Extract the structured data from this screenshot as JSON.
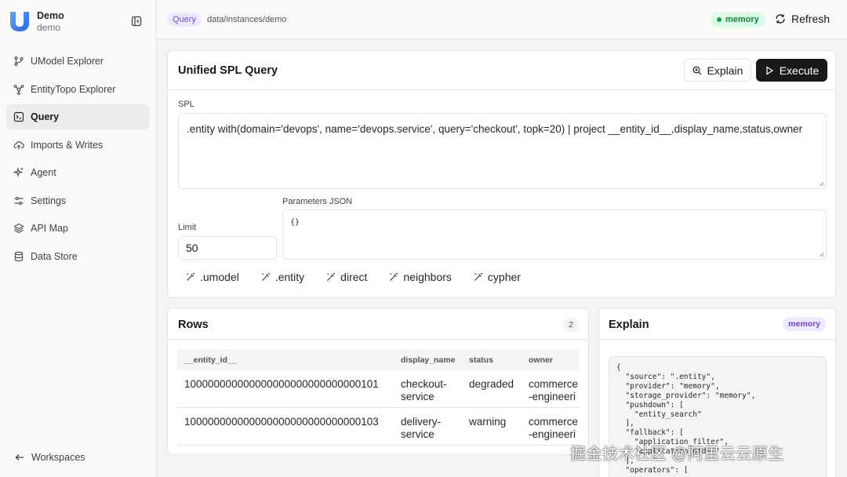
{
  "app": {
    "name": "Demo",
    "workspace": "demo"
  },
  "sidebar": {
    "items": [
      {
        "label": "UModel Explorer",
        "icon": "git-branch-icon"
      },
      {
        "label": "EntityTopo Explorer",
        "icon": "topology-icon"
      },
      {
        "label": "Query",
        "icon": "terminal-square-icon",
        "active": true
      },
      {
        "label": "Imports & Writes",
        "icon": "cloud-upload-icon"
      },
      {
        "label": "Agent",
        "icon": "sparkles-icon"
      },
      {
        "label": "Settings",
        "icon": "sliders-icon"
      },
      {
        "label": "API Map",
        "icon": "layers-icon"
      },
      {
        "label": "Data Store",
        "icon": "database-icon"
      }
    ],
    "footer_label": "Workspaces"
  },
  "topbar": {
    "section_badge": "Query",
    "path": "data/instances/demo",
    "status_badge": "memory",
    "refresh_label": "Refresh"
  },
  "query_card": {
    "title": "Unified SPL Query",
    "explain_label": "Explain",
    "execute_label": "Execute",
    "spl_label": "SPL",
    "spl_value": ".entity with(domain='devops', name='devops.service', query='checkout', topk=20) | project __entity_id__,display_name,status,owner",
    "params_label": "Parameters JSON",
    "params_value": "{}",
    "limit_label": "Limit",
    "limit_value": "50",
    "templates": [
      ".umodel",
      ".entity",
      "direct",
      "neighbors",
      "cypher"
    ]
  },
  "rows_card": {
    "title": "Rows",
    "count": "2",
    "columns": [
      "__entity_id__",
      "display_name",
      "status",
      "owner"
    ],
    "rows": [
      [
        "100000000000000000000000000000101",
        "checkout-service",
        "degraded",
        "commerce-engineering"
      ],
      [
        "100000000000000000000000000000103",
        "delivery-service",
        "warning",
        "commerce-engineering"
      ]
    ]
  },
  "explain_card": {
    "title": "Explain",
    "badge": "memory",
    "code": "{\n  \"source\": \".entity\",\n  \"provider\": \"memory\",\n  \"storage_provider\": \"memory\",\n  \"pushdown\": [\n    \"entity_search\"\n  ],\n  \"fallback\": [\n    \"application_filter\",\n    \"application_order\"\n  ],\n  \"operators\": ["
  },
  "watermark": "掘金技术社区 @阿里云云原生",
  "colors": {
    "accent": "#7c3aed",
    "accent_bg": "#ede9fe",
    "success": "#16a34a",
    "primary_button": "#18181b"
  }
}
